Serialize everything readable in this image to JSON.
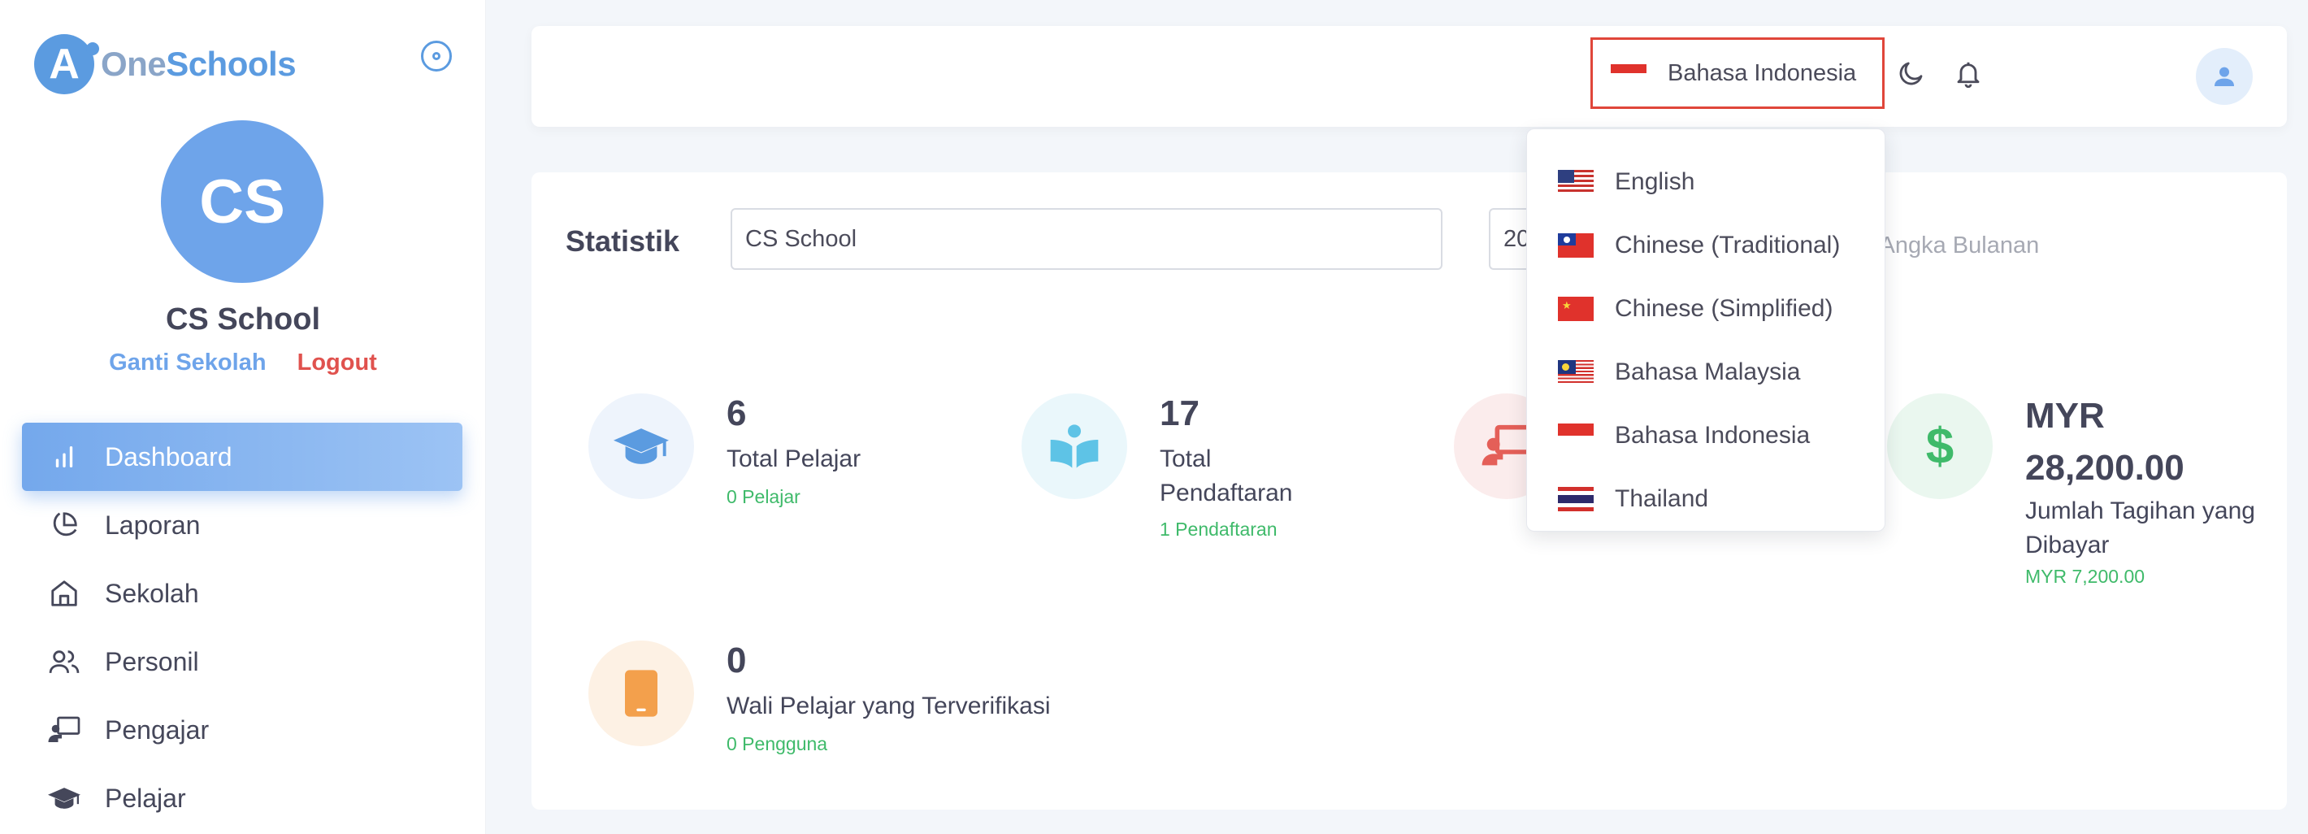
{
  "brand": {
    "logo_letter": "A",
    "name_part1": "One",
    "name_part2": "Schools"
  },
  "school": {
    "initials": "CS",
    "name": "CS School",
    "switch_label": "Ganti Sekolah",
    "logout_label": "Logout"
  },
  "nav": [
    {
      "label": "Dashboard",
      "icon": "bar-chart-icon",
      "active": true
    },
    {
      "label": "Laporan",
      "icon": "pie-chart-icon",
      "active": false
    },
    {
      "label": "Sekolah",
      "icon": "home-icon",
      "active": false
    },
    {
      "label": "Personil",
      "icon": "users-icon",
      "active": false
    },
    {
      "label": "Pengajar",
      "icon": "teacher-icon",
      "active": false
    },
    {
      "label": "Pelajar",
      "icon": "graduation-cap-icon",
      "active": false
    }
  ],
  "header": {
    "language_selected": "Bahasa Indonesia"
  },
  "statistik": {
    "title": "Statistik",
    "school_value": "CS School",
    "year_value": "20",
    "hint": ", Angka Bulanan"
  },
  "stats": [
    {
      "number": "6",
      "label": "Total Pelajar",
      "sub": "0 Pelajar",
      "icon": "graduation-cap-icon",
      "color": "#5b9be0",
      "bg": "#eef4fc"
    },
    {
      "number": "17",
      "label": "Total Pendaftaran",
      "sub": "1 Pendaftaran",
      "icon": "open-book-icon",
      "color": "#5ec3e6",
      "bg": "#eaf7fb"
    },
    {
      "number": "",
      "label": "",
      "sub": "",
      "icon": "teacher-board-icon",
      "color": "#e45f58",
      "bg": "#fbecec"
    },
    {
      "number": "MYR 28,200.00",
      "label": "Jumlah Tagihan yang Dibayar",
      "sub": "MYR 7,200.00",
      "icon": "dollar-icon",
      "color": "#3fba6a",
      "bg": "#eaf7ef"
    },
    {
      "number": "0",
      "label": "Wali Pelajar yang Terverifikasi",
      "sub": "0 Pengguna",
      "icon": "tablet-icon",
      "color": "#f3a04c",
      "bg": "#fdf1e4"
    }
  ],
  "languages": [
    {
      "label": "English",
      "flag": "us-flag-icon"
    },
    {
      "label": "Chinese (Traditional)",
      "flag": "taiwan-flag-icon"
    },
    {
      "label": "Chinese (Simplified)",
      "flag": "china-flag-icon"
    },
    {
      "label": "Bahasa Malaysia",
      "flag": "malaysia-flag-icon"
    },
    {
      "label": "Bahasa Indonesia",
      "flag": "indonesia-flag-icon"
    },
    {
      "label": "Thailand",
      "flag": "thailand-flag-icon"
    }
  ],
  "colors": {
    "accent": "#6ea4ea",
    "logout": "#e0524e",
    "success": "#3fba6a",
    "highlight_border": "#e0463a"
  }
}
